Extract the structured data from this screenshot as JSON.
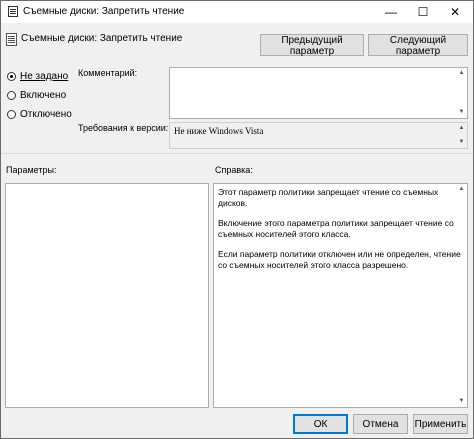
{
  "window": {
    "title": "Съемные диски: Запретить чтение",
    "minimize_glyph": "—",
    "maximize_glyph": "☐",
    "close_glyph": "✕"
  },
  "header": {
    "title": "Съемные диски: Запретить чтение",
    "prev_button": "Предыдущий параметр",
    "next_button": "Следующий параметр"
  },
  "state": {
    "options": [
      "Не задано",
      "Включено",
      "Отключено"
    ],
    "selected": "Не задано"
  },
  "comment": {
    "label": "Комментарий:",
    "value": ""
  },
  "supported": {
    "label": "Требования к версии:",
    "value": "Не ниже Windows Vista"
  },
  "options_pane": {
    "label": "Параметры:"
  },
  "help_pane": {
    "label": "Справка:",
    "paragraphs": [
      "Этот параметр политики запрещает чтение со съемных дисков.",
      "Включение этого параметра политики запрещает чтение со съемных носителей этого класса.",
      "Если параметр политики отключен или не определен, чтение со съемных носителей этого класса разрешено."
    ]
  },
  "footer": {
    "ok": "ОК",
    "cancel": "Отмена",
    "apply": "Применить"
  }
}
